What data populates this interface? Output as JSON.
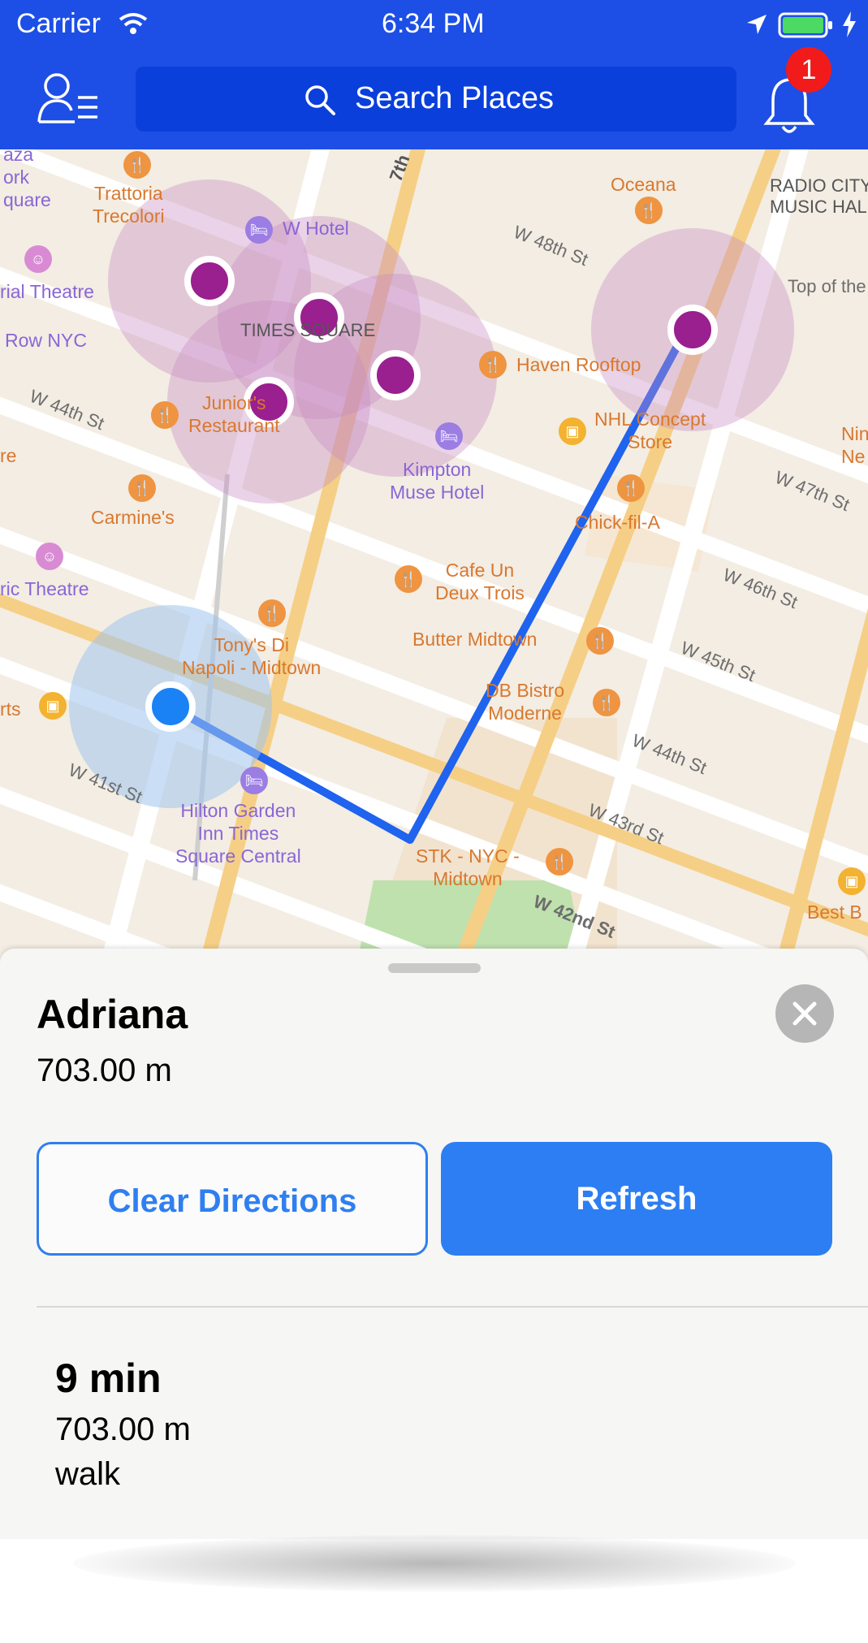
{
  "status_bar": {
    "carrier": "Carrier",
    "time": "6:34 PM",
    "icons": [
      "wifi-icon",
      "location-arrow-icon",
      "battery-icon",
      "charging-bolt-icon"
    ]
  },
  "nav_bar": {
    "menu_icon": "user-list-icon",
    "search_placeholder": "Search Places",
    "notification_count": "1",
    "colors": {
      "bar": "#1d4fe6",
      "search": "#0a3fdc",
      "badge": "#f21b1b"
    }
  },
  "map": {
    "labels": {
      "trattoria": "Trattoria\nTrecolori",
      "w_hotel": "W Hotel",
      "oceana": "Oceana",
      "radio_city": "RADIO CITY\nMUSIC HALL",
      "w48": "W 48th St",
      "top_of": "Top of the",
      "theatre1": "rial Theatre",
      "row_nyc": "Row NYC",
      "times_square": "TIMES SQUARE",
      "haven": "Haven Rooftop",
      "w44a": "W 44th St",
      "junior": "Junior's\nRestaurant",
      "nhl": "NHL Concept\nStore",
      "kimpton": "Kimpton\nMuse Hotel",
      "w47": "W 47th St",
      "ne": "Nin\nNe",
      "re": "re",
      "carmines": "Carmine's",
      "chickfila": "Chick-fil-A",
      "theatre2": "ric Theatre",
      "cafe_un": "Cafe Un\nDeux Trois",
      "w46": "W 46th St",
      "tonys": "Tony's Di\nNapoli - Midtown",
      "butter": "Butter Midtown",
      "w45": "W 45th St",
      "rts": "rts",
      "db_bistro": "DB Bistro\nModerne",
      "w44b": "W 44th St",
      "w41": "W 41st St",
      "hilton": "Hilton Garden\nInn Times\nSquare Central",
      "w43": "W 43rd St",
      "stk": "STK - NYC -\nMidtown",
      "w42": "W 42nd St",
      "best": "Best B",
      "seventh": "7th",
      "aza": "aza\nork\nquare"
    },
    "colors": {
      "route": "#1f63ee",
      "user_dot": "#1a82f5",
      "pin": "#9a1f8f",
      "pin_halo": "#c98bc2",
      "user_halo": "#9fc4ee"
    }
  },
  "sheet": {
    "title": "Adriana",
    "distance": "703.00 m",
    "clear_label": "Clear Directions",
    "refresh_label": "Refresh",
    "eta": "9 min",
    "eta_distance": "703.00 m",
    "eta_mode": "walk",
    "colors": {
      "primary": "#2d7ef2",
      "close_bg": "#b6b6b6"
    }
  }
}
